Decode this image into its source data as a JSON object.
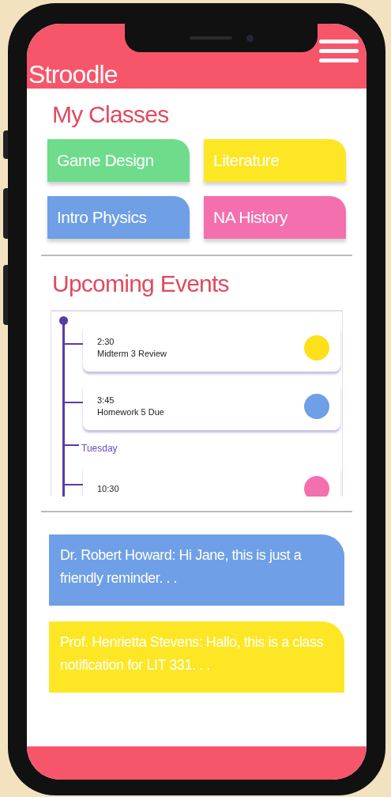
{
  "app": {
    "title": "Stroodle"
  },
  "classes": {
    "title": "My Classes",
    "items": [
      {
        "name": "Game Design",
        "color": "#6fdc8c"
      },
      {
        "name": "Literature",
        "color": "#fde725"
      },
      {
        "name": "Intro Physics",
        "color": "#6f9fe6"
      },
      {
        "name": "NA History",
        "color": "#f46fae"
      }
    ]
  },
  "events": {
    "title": "Upcoming Events",
    "items": [
      {
        "kind": "event",
        "time": "2:30",
        "title": "Midterm 3 Review",
        "color": "#fde01a"
      },
      {
        "kind": "event",
        "time": "3:45",
        "title": "Homework 5 Due",
        "color": "#6f9fe6"
      },
      {
        "kind": "day",
        "label": "Tuesday"
      },
      {
        "kind": "event",
        "time": "10:30",
        "color": "#f46fae"
      }
    ]
  },
  "messages": [
    {
      "text": "Dr. Robert Howard: Hi Jane, this is just a friendly reminder. . .",
      "color": "#6f9fe6"
    },
    {
      "text": "Prof. Henrietta Stevens: Hallo, this is a class notification for LIT 331. . .",
      "color": "#fde725"
    }
  ]
}
